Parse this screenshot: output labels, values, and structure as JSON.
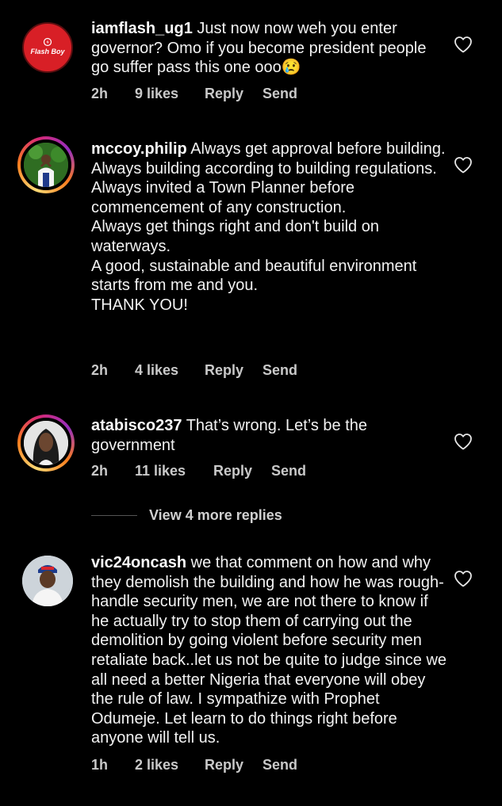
{
  "colors": {
    "background": "#000000",
    "text": "#f2f2f2",
    "meta": "#c9c9c9",
    "story_ring_start": "#feda75",
    "story_ring_end": "#d62976",
    "flashboy_red": "#d81f26"
  },
  "comments": [
    {
      "username": "iamflash_ug1",
      "text": " Just now now weh you enter governor? Omo if you become president people go suffer pass this one ooo😢",
      "time": "2h",
      "likes": "9 likes",
      "reply": "Reply",
      "send": "Send",
      "avatar_label": "Flash Boy",
      "heart_icon": "heart-outline-icon"
    },
    {
      "username": "mccoy.philip",
      "text": " Always get approval before building.\nAlways building according to building regulations.\nAlways invited a Town Planner before commencement of any construction.\nAlways get things right and don't build on waterways.\nA good, sustainable and beautiful environment starts from me and you.\nTHANK YOU!",
      "time": "2h",
      "likes": "4 likes",
      "reply": "Reply",
      "send": "Send",
      "heart_icon": "heart-outline-icon"
    },
    {
      "username": "atabisco237",
      "text": " That’s wrong. Let’s be the government",
      "time": "2h",
      "likes": "11 likes",
      "reply": "Reply",
      "send": "Send",
      "heart_icon": "heart-outline-icon"
    },
    {
      "username": "vic24oncash",
      "text": " we that comment on how and why they demolish the building and how he was rough-handle security men, we are not there to know if he actually try to stop them of carrying out the demolition by going violent before security men retaliate back..let us not be quite to judge since we all need a better Nigeria that everyone will obey the rule of law. I sympathize with Prophet Odumeje. Let learn to do things right before anyone will tell us.",
      "time": "1h",
      "likes": "2 likes",
      "reply": "Reply",
      "send": "Send",
      "heart_icon": "heart-outline-icon"
    }
  ],
  "view_more_replies": "View 4 more replies"
}
